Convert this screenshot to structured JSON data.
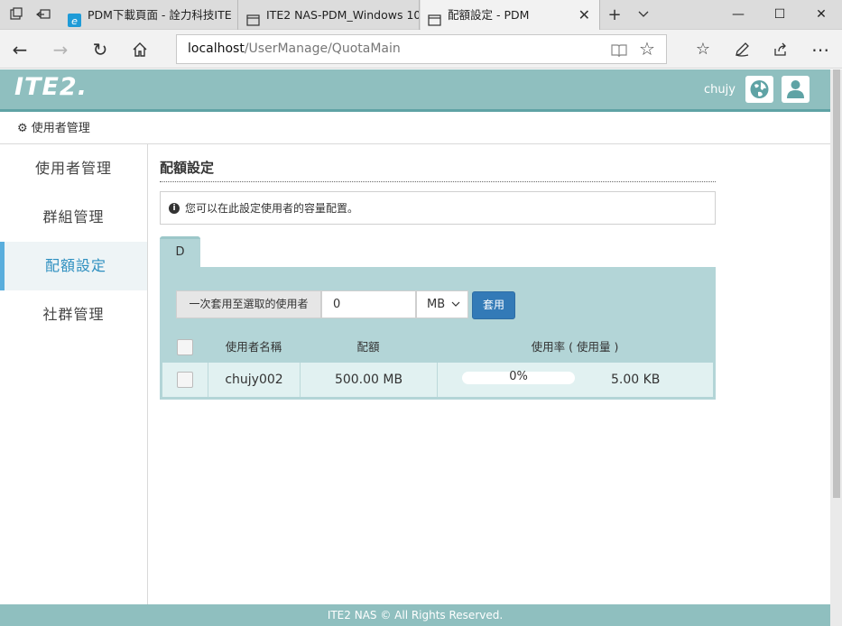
{
  "browser": {
    "tabs": [
      {
        "label": "PDM下載頁面 - 詮力科技ITE"
      },
      {
        "label": "ITE2 NAS-PDM_Windows 10"
      },
      {
        "label": "配額設定 - PDM",
        "active": true
      }
    ],
    "address": {
      "host": "localhost",
      "path": "/UserManage/QuotaMain"
    },
    "icons": [
      "tab-actions-icon",
      "set-aside-tabs-icon",
      "back-icon",
      "forward-icon",
      "refresh-icon",
      "home-icon",
      "reading-view-icon",
      "favorite-star-icon",
      "favorites-list-icon",
      "pen-icon",
      "share-icon",
      "more-icon"
    ]
  },
  "header": {
    "logo": "ITE2.",
    "user": "chujy",
    "colors": {
      "bar": "#8fbfbf",
      "accent": "#5fa3a5"
    }
  },
  "breadcrumb": {
    "label": "使用者管理"
  },
  "sidebar": {
    "items": [
      {
        "label": "使用者管理"
      },
      {
        "label": "群組管理"
      },
      {
        "label": "配額設定",
        "active": true
      },
      {
        "label": "社群管理"
      }
    ]
  },
  "main": {
    "title": "配額設定",
    "info": "您可以在此設定使用者的容量配置。",
    "drive_tab": "D",
    "apply_all": {
      "label": "一次套用至選取的使用者",
      "value": "0",
      "unit": "MB",
      "button": "套用"
    },
    "table": {
      "headers": [
        "使用者名稱",
        "配額",
        "使用率 ( 使用量 )"
      ],
      "rows": [
        {
          "user": "chujy002",
          "quota": "500.00 MB",
          "usage_pct": "0%",
          "usage_fraction": 0,
          "used": "5.00 KB"
        }
      ]
    }
  },
  "footer": {
    "text": "ITE2 NAS © All Rights Reserved."
  }
}
